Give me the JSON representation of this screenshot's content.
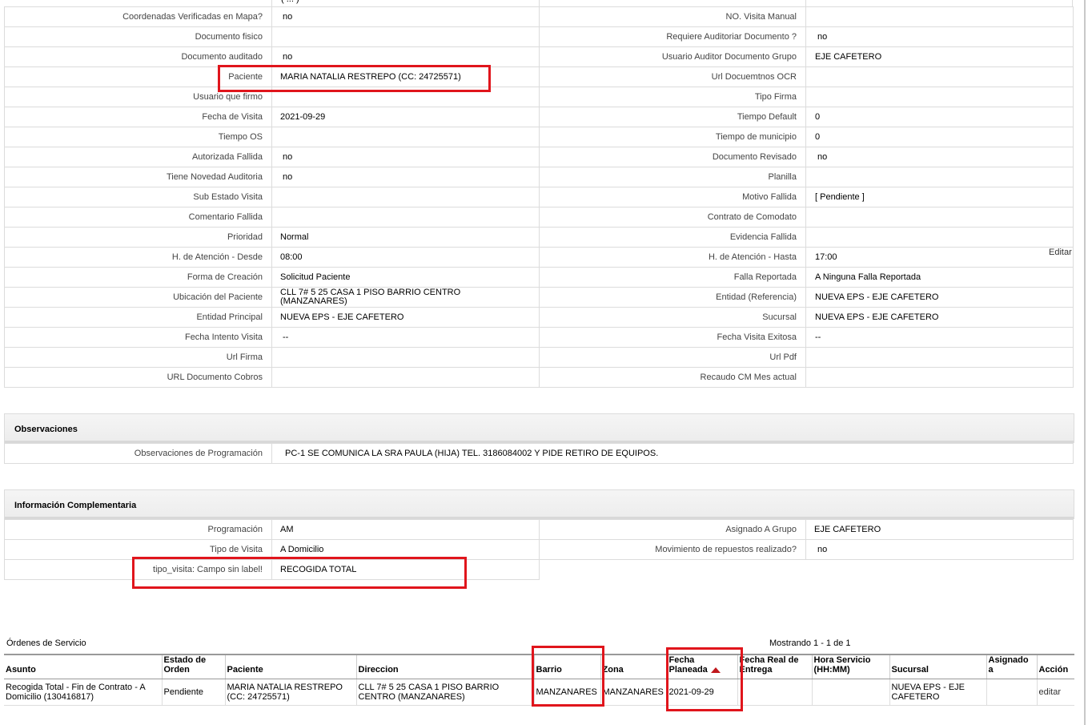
{
  "top_partial_value": "( ... )",
  "details_left": [
    {
      "label": "Coordenadas Verificadas en Mapa?",
      "value": "no"
    },
    {
      "label": "Documento fisico",
      "value": ""
    },
    {
      "label": "Documento auditado",
      "value": "no"
    },
    {
      "label": "Paciente",
      "value": "MARIA NATALIA RESTREPO (CC: 24725571)"
    },
    {
      "label": "Usuario que firmo",
      "value": ""
    },
    {
      "label": "Fecha de Visita",
      "value": "2021-09-29"
    },
    {
      "label": "Tiempo OS",
      "value": ""
    },
    {
      "label": "Autorizada Fallida",
      "value": "no"
    },
    {
      "label": "Tiene Novedad Auditoria",
      "value": "no"
    },
    {
      "label": "Sub Estado Visita",
      "value": ""
    },
    {
      "label": "Comentario Fallida",
      "value": ""
    },
    {
      "label": "Prioridad",
      "value": "Normal"
    },
    {
      "label": "H. de Atención - Desde",
      "value": "08:00"
    },
    {
      "label": "Forma de Creación",
      "value": "Solicitud Paciente"
    },
    {
      "label": "Ubicación del Paciente",
      "value": "CLL 7# 5 25 CASA 1 PISO BARRIO CENTRO (MANZANARES)"
    },
    {
      "label": "Entidad Principal",
      "value": "NUEVA EPS - EJE CAFETERO"
    },
    {
      "label": "Fecha Intento Visita",
      "value": "--"
    },
    {
      "label": "Url Firma",
      "value": ""
    },
    {
      "label": "URL Documento Cobros",
      "value": ""
    }
  ],
  "details_right": [
    {
      "label": "NO. Visita Manual",
      "value": ""
    },
    {
      "label": "Requiere Auditoriar Documento ?",
      "value": "no"
    },
    {
      "label": "Usuario Auditor Documento Grupo",
      "value": "EJE CAFETERO"
    },
    {
      "label": "Url Docuemtnos OCR",
      "value": ""
    },
    {
      "label": "Tipo Firma",
      "value": ""
    },
    {
      "label": "Tiempo Default",
      "value": "0"
    },
    {
      "label": "Tiempo de municipio",
      "value": "0"
    },
    {
      "label": "Documento Revisado",
      "value": "no"
    },
    {
      "label": "Planilla",
      "value": ""
    },
    {
      "label": "Motivo Fallida",
      "value": "[ Pendiente ]"
    },
    {
      "label": "Contrato de Comodato",
      "value": ""
    },
    {
      "label": "Evidencia Fallida",
      "value": ""
    },
    {
      "label": "H. de Atención - Hasta",
      "value": "17:00"
    },
    {
      "label": "Falla Reportada",
      "value": "A Ninguna Falla Reportada"
    },
    {
      "label": "Entidad (Referencia)",
      "value": "NUEVA EPS - EJE CAFETERO"
    },
    {
      "label": "Sucursal",
      "value": "NUEVA EPS - EJE CAFETERO"
    },
    {
      "label": "Fecha Visita Exitosa",
      "value": "--"
    },
    {
      "label": "Url Pdf",
      "value": ""
    },
    {
      "label": "Recaudo CM Mes actual",
      "value": ""
    }
  ],
  "edit_link": "Editar",
  "observaciones": {
    "title": "Observaciones",
    "label": "Observaciones de Programación",
    "value": "PC-1 SE COMUNICA LA SRA PAULA (HIJA) TEL. 3186084002 Y PIDE RETIRO DE EQUIPOS."
  },
  "info_comp": {
    "title": "Información Complementaria",
    "rows": [
      {
        "l_label": "Programación",
        "l_value": "AM",
        "r_label": "Asignado A Grupo",
        "r_value": "EJE CAFETERO"
      },
      {
        "l_label": "Tipo de Visita",
        "l_value": "A Domicilio",
        "r_label": "Movimiento de repuestos realizado?",
        "r_value": "no"
      },
      {
        "l_label": "tipo_visita: Campo sin label!",
        "l_value": "RECOGIDA TOTAL"
      }
    ]
  },
  "orders": {
    "title": "Órdenes de Servicio",
    "showing": "Mostrando 1 - 1 de 1",
    "columns": [
      "Asunto",
      "Estado de Orden",
      "Paciente",
      "Direccion",
      "Barrio",
      "Zona",
      "Fecha Planeada",
      "Fecha Real de Entrega",
      "Hora Servicio (HH:MM)",
      "Sucursal",
      "Asignado a",
      "Acción"
    ],
    "rows": [
      {
        "asunto": "Recogida Total - Fin de Contrato - A Domicilio (130416817)",
        "estado": "Pendiente",
        "paciente": "MARIA NATALIA RESTREPO (CC: 24725571)",
        "direccion": "CLL 7# 5 25 CASA 1 PISO BARRIO CENTRO (MANZANARES)",
        "barrio": "MANZANARES",
        "zona": "MANZANARES",
        "fecha_planeada": "2021-09-29",
        "fecha_real": "",
        "hora": "",
        "sucursal": "NUEVA EPS - EJE CAFETERO",
        "asignado": "",
        "accion": "editar"
      }
    ]
  }
}
